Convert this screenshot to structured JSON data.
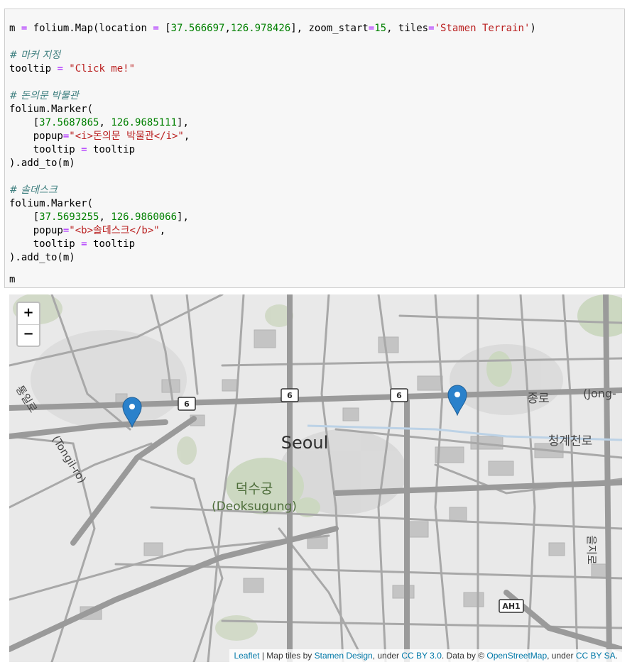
{
  "code": {
    "map_call": {
      "prefix": "m ",
      "eq": "=",
      "a": " folium.Map(location ",
      "eq2": "=",
      "b": " [",
      "lat": "37.566697",
      "c": ",",
      "lon": "126.978426",
      "d": "], zoom_start",
      "eq3": "=",
      "zoom": "15",
      "e": ", tiles",
      "eq4": "=",
      "tiles": "'Stamen Terrain'",
      "f": ")"
    },
    "comment_marker": "# 마커 지정",
    "tooltip_line": {
      "name": "tooltip ",
      "eq": "=",
      "value": " \"Click me!\""
    },
    "comment_museum": "# 돈의문 박물관",
    "marker1": {
      "open": "folium.Marker(",
      "indent_bracket": "    [",
      "lat": "37.5687865",
      "sep": ", ",
      "lon": "126.9685111",
      "close_bracket": "],",
      "popup_key": "    popup",
      "popup_eq": "=",
      "popup_val": "\"<i>돈의문 박물관</i>\"",
      "popup_comma": ",",
      "tooltip_key": "    tooltip ",
      "tooltip_eq": "=",
      "tooltip_val": " tooltip",
      "close": ").add_to(m)"
    },
    "comment_soldesk": "# 솔데스크",
    "marker2": {
      "open": "folium.Marker(",
      "indent_bracket": "    [",
      "lat": "37.5693255",
      "sep": ", ",
      "lon": "126.9860066",
      "close_bracket": "],",
      "popup_key": "    popup",
      "popup_eq": "=",
      "popup_val": "\"<b>솔데스크</b>\"",
      "popup_comma": ",",
      "tooltip_key": "    tooltip ",
      "tooltip_eq": "=",
      "tooltip_val": " tooltip",
      "close": ").add_to(m)"
    },
    "last_line": "m"
  },
  "map": {
    "zoom_in": "+",
    "zoom_out": "−",
    "labels": {
      "seoul": "Seoul",
      "deoksugung_ko": "덕수궁",
      "deoksugung_en": "(Deoksugung)",
      "jongno_ko": "종로",
      "jongno_en": "(Jong-",
      "cheonggyecheon": "청계천로",
      "tongil": "(Tongil-ro)",
      "tongil_ko": "통일로",
      "euljiro": "을지로",
      "route_6a": "6",
      "route_6b": "6",
      "route_6c": "6",
      "ah1": "AH1"
    },
    "marker_color": "#2a81cb",
    "attribution": {
      "leaflet": "Leaflet",
      "tiles_text": " | Map tiles by ",
      "stamen": "Stamen Design",
      "under1": ", under ",
      "cc1": "CC BY 3.0",
      "data_text": ". Data by © ",
      "osm": "OpenStreetMap",
      "under2": ", under ",
      "cc2": "CC BY SA",
      "end": "."
    }
  }
}
